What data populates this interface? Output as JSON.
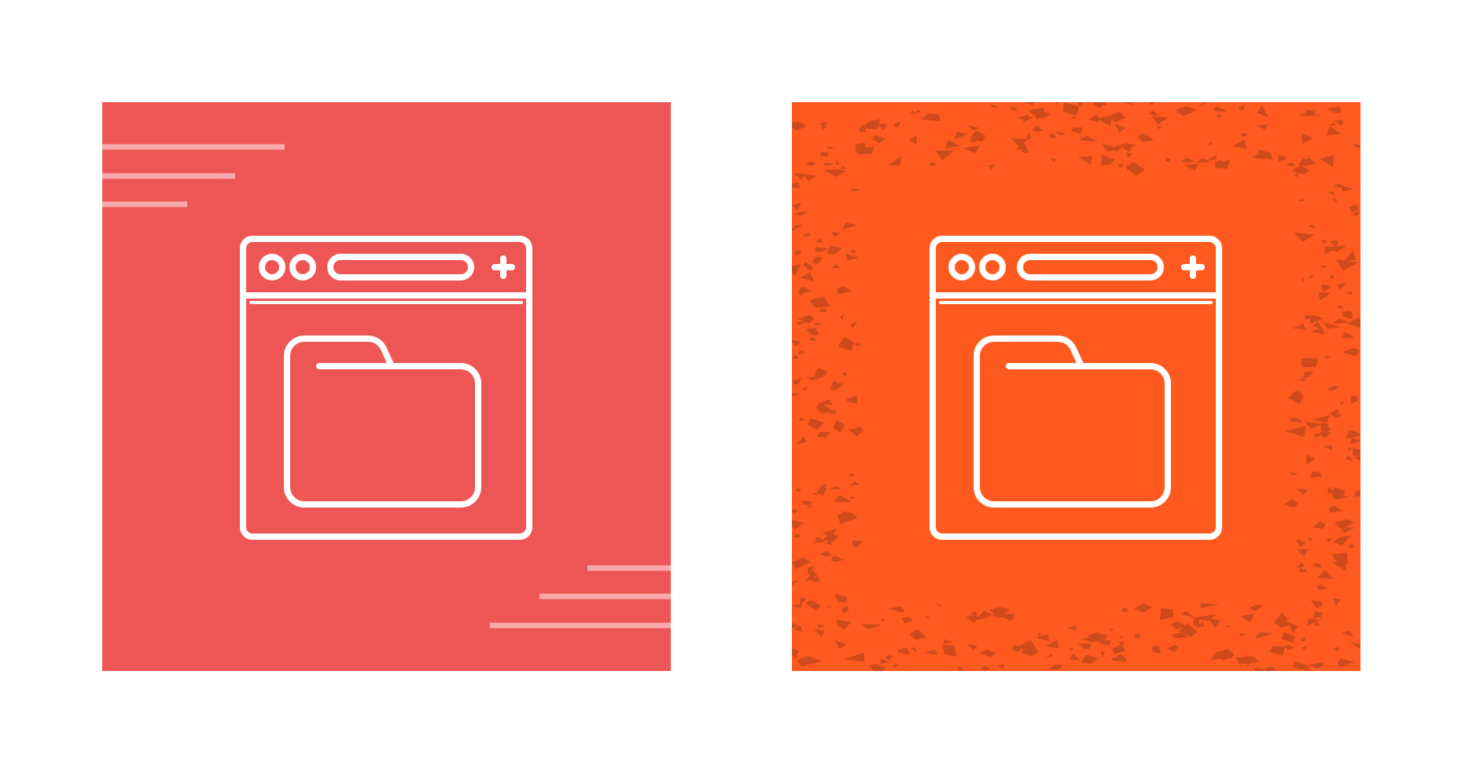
{
  "canvas": {
    "background": "#ffffff"
  },
  "icons": [
    {
      "name": "browser-folder-icon",
      "style": "flat-with-speed-lines",
      "background_color": "#ee5555",
      "line_color": "#ffffff",
      "accent_line_color": "#f8aaaa"
    },
    {
      "name": "browser-folder-icon",
      "style": "grunge-texture",
      "background_color": "#fe5a1f",
      "line_color": "#ffffff",
      "texture_color": "#cf4a1b"
    }
  ]
}
